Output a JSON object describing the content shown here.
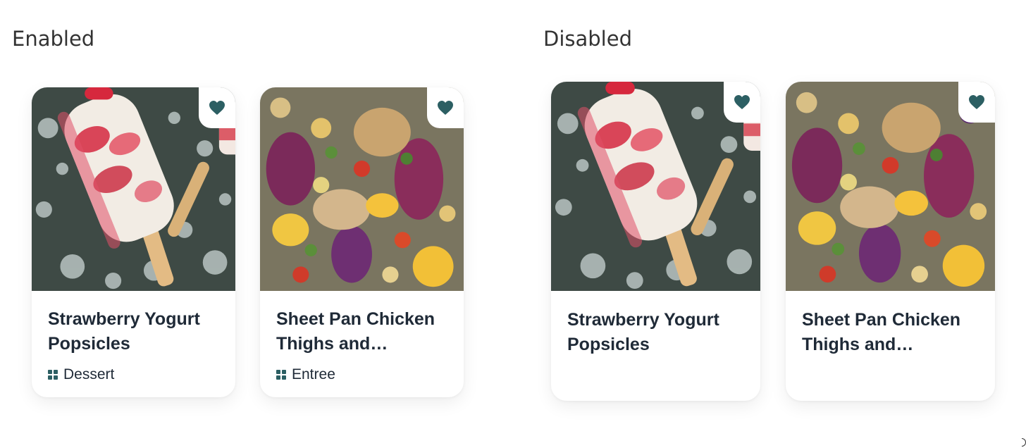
{
  "sections": {
    "enabled_title": "Enabled",
    "disabled_title": "Disabled"
  },
  "enabled_cards": [
    {
      "title": "Strawberry Yogurt Popsicles",
      "category": "Dessert",
      "category_icon": "grid-icon",
      "favorite_icon": "heart-icon"
    },
    {
      "title": "Sheet Pan Chicken Thighs and…",
      "category": "Entree",
      "category_icon": "grid-icon",
      "favorite_icon": "heart-icon"
    }
  ],
  "disabled_cards": [
    {
      "title": "Strawberry Yogurt Popsicles",
      "favorite_icon": "heart-icon"
    },
    {
      "title": "Sheet Pan Chicken Thighs and…",
      "favorite_icon": "heart-icon"
    }
  ],
  "colors": {
    "accent": "#2c5f63",
    "text": "#1f2a37",
    "card_bg": "#ffffff"
  }
}
